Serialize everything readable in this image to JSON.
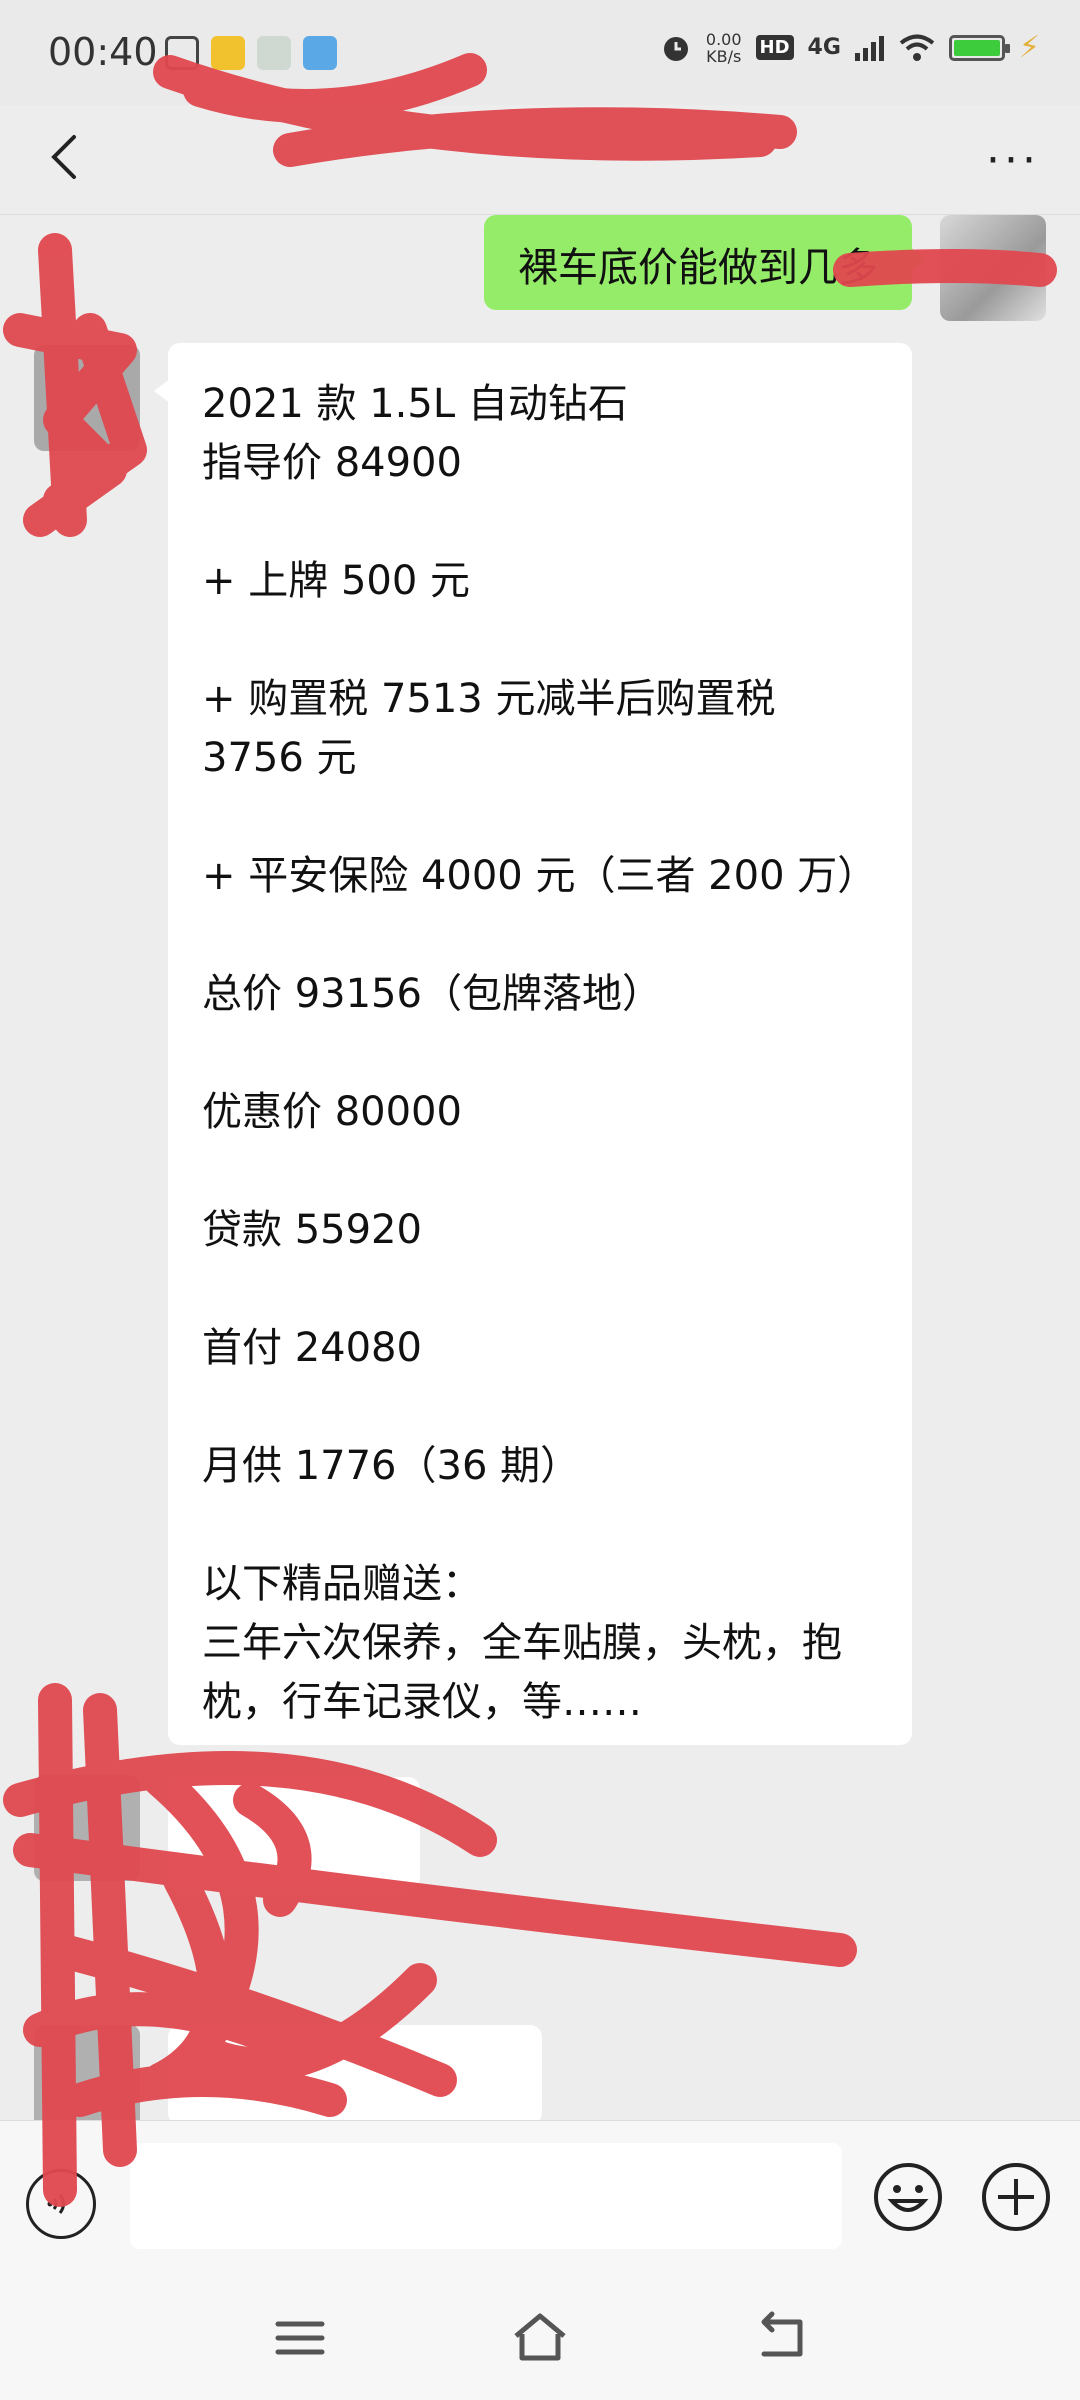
{
  "status_bar": {
    "time": "00:40",
    "speed_value": "0.00",
    "speed_unit": "KB/s",
    "hd_badge": "HD",
    "network": "4G",
    "battery_color": "#3ccc3c"
  },
  "header": {
    "title": "",
    "more_label": "···"
  },
  "messages": {
    "sent_1": "裸车底价能做到几多",
    "received_1": "2021 款 1.5L 自动钻石\n指导价 84900\n\n+ 上牌 500 元\n\n+ 购置税 7513 元减半后购置税 3756 元\n\n+ 平安保险 4000 元（三者 200 万）\n\n总价 93156（包牌落地）\n\n优惠价 80000\n\n贷款 55920\n\n首付 24080\n\n月供 1776（36 期）\n\n以下精品赠送：\n三年六次保养，全车贴膜，头枕，抱枕，行车记录仪，等……"
  },
  "input": {
    "placeholder": ""
  },
  "colors": {
    "sent_bubble": "#95ec69",
    "received_bubble": "#ffffff",
    "background": "#ededed",
    "redaction": "#e0484f"
  }
}
